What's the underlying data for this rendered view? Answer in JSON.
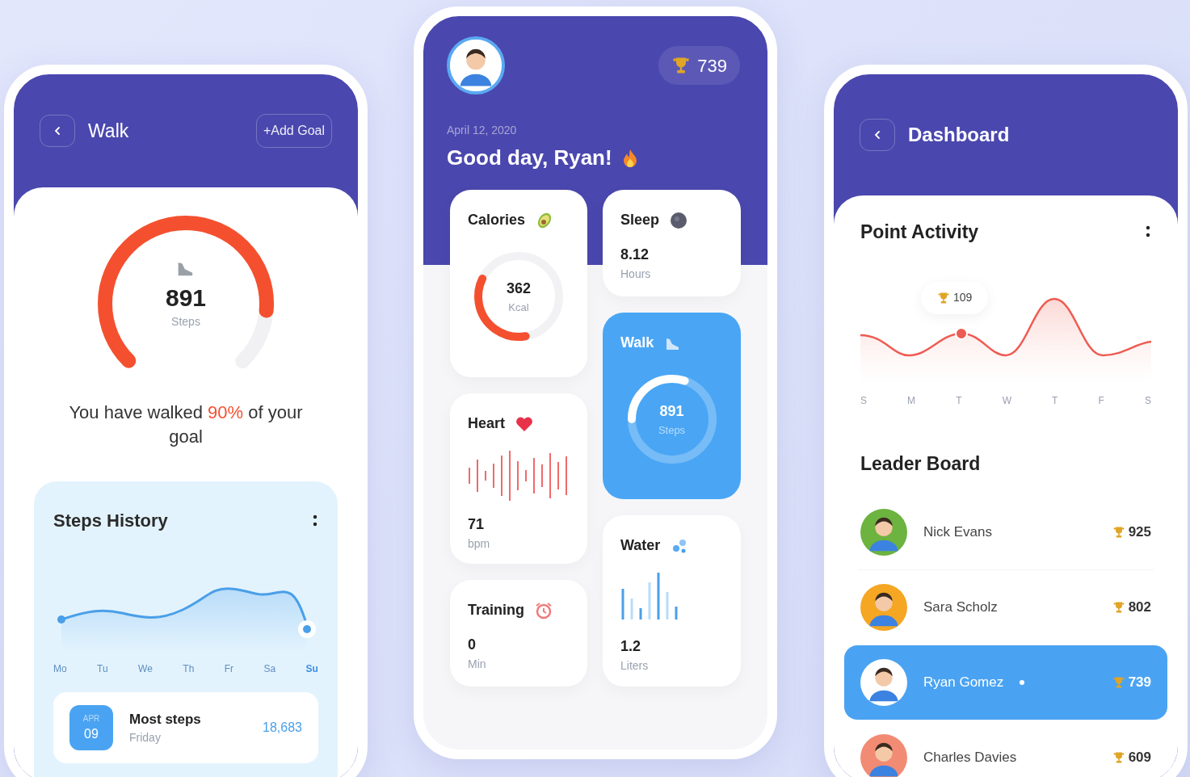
{
  "walk_screen": {
    "title": "Walk",
    "add_goal_button": "+Add Goal",
    "gauge": {
      "level": 0.85,
      "value": "891",
      "unit": "Steps"
    },
    "message": {
      "before": "You have walked",
      "highlight": "90%",
      "after": "of your goal"
    },
    "steps_history": {
      "title": "Steps History",
      "days": [
        {
          "label": "Mo",
          "selected": false
        },
        {
          "label": "Tu",
          "selected": false
        },
        {
          "label": "We",
          "selected": false
        },
        {
          "label": "Th",
          "selected": false
        },
        {
          "label": "Fr",
          "selected": false
        },
        {
          "label": "Sa",
          "selected": false
        },
        {
          "label": "Su",
          "selected": true
        }
      ]
    },
    "most_steps": {
      "month": "APR",
      "day": "09",
      "title": "Most steps",
      "weekday": "Friday",
      "value": "18,683"
    }
  },
  "home_screen": {
    "points": "739",
    "date": "April 12, 2020",
    "greeting": "Good day, Ryan!",
    "left_cards": [
      {
        "kind": "ring",
        "title": "Calories",
        "value": "362",
        "unit": "Kcal",
        "level": 0.35
      },
      {
        "kind": "wave",
        "title": "Heart",
        "value": "71",
        "unit": "bpm"
      },
      {
        "kind": "stat",
        "title": "Training",
        "value": "0",
        "unit": "Min"
      }
    ],
    "right_cards": [
      {
        "kind": "stat",
        "title": "Sleep",
        "value": "8.12",
        "unit": "Hours"
      },
      {
        "kind": "ring_accent",
        "title": "Walk",
        "value": "891",
        "unit": "Steps",
        "level": 0.3
      },
      {
        "kind": "bars",
        "title": "Water",
        "value": "1.2",
        "unit": "Liters"
      }
    ]
  },
  "dashboard_screen": {
    "title": "Dashboard",
    "point_activity": {
      "title": "Point Activity",
      "marker": "109",
      "days": [
        "S",
        "M",
        "T",
        "W",
        "T",
        "F",
        "S"
      ]
    },
    "leader_board": {
      "title": "Leader Board",
      "rows": [
        {
          "name": "Nick Evans",
          "points": "925",
          "selected": false,
          "color": "#6cb33f"
        },
        {
          "name": "Sara Scholz",
          "points": "802",
          "selected": false,
          "color": "#f5a623"
        },
        {
          "name": "Ryan Gomez",
          "points": "739",
          "selected": true,
          "color": "#ffffff"
        },
        {
          "name": "Charles Davies",
          "points": "609",
          "selected": false,
          "color": "#f28b74"
        }
      ]
    }
  }
}
